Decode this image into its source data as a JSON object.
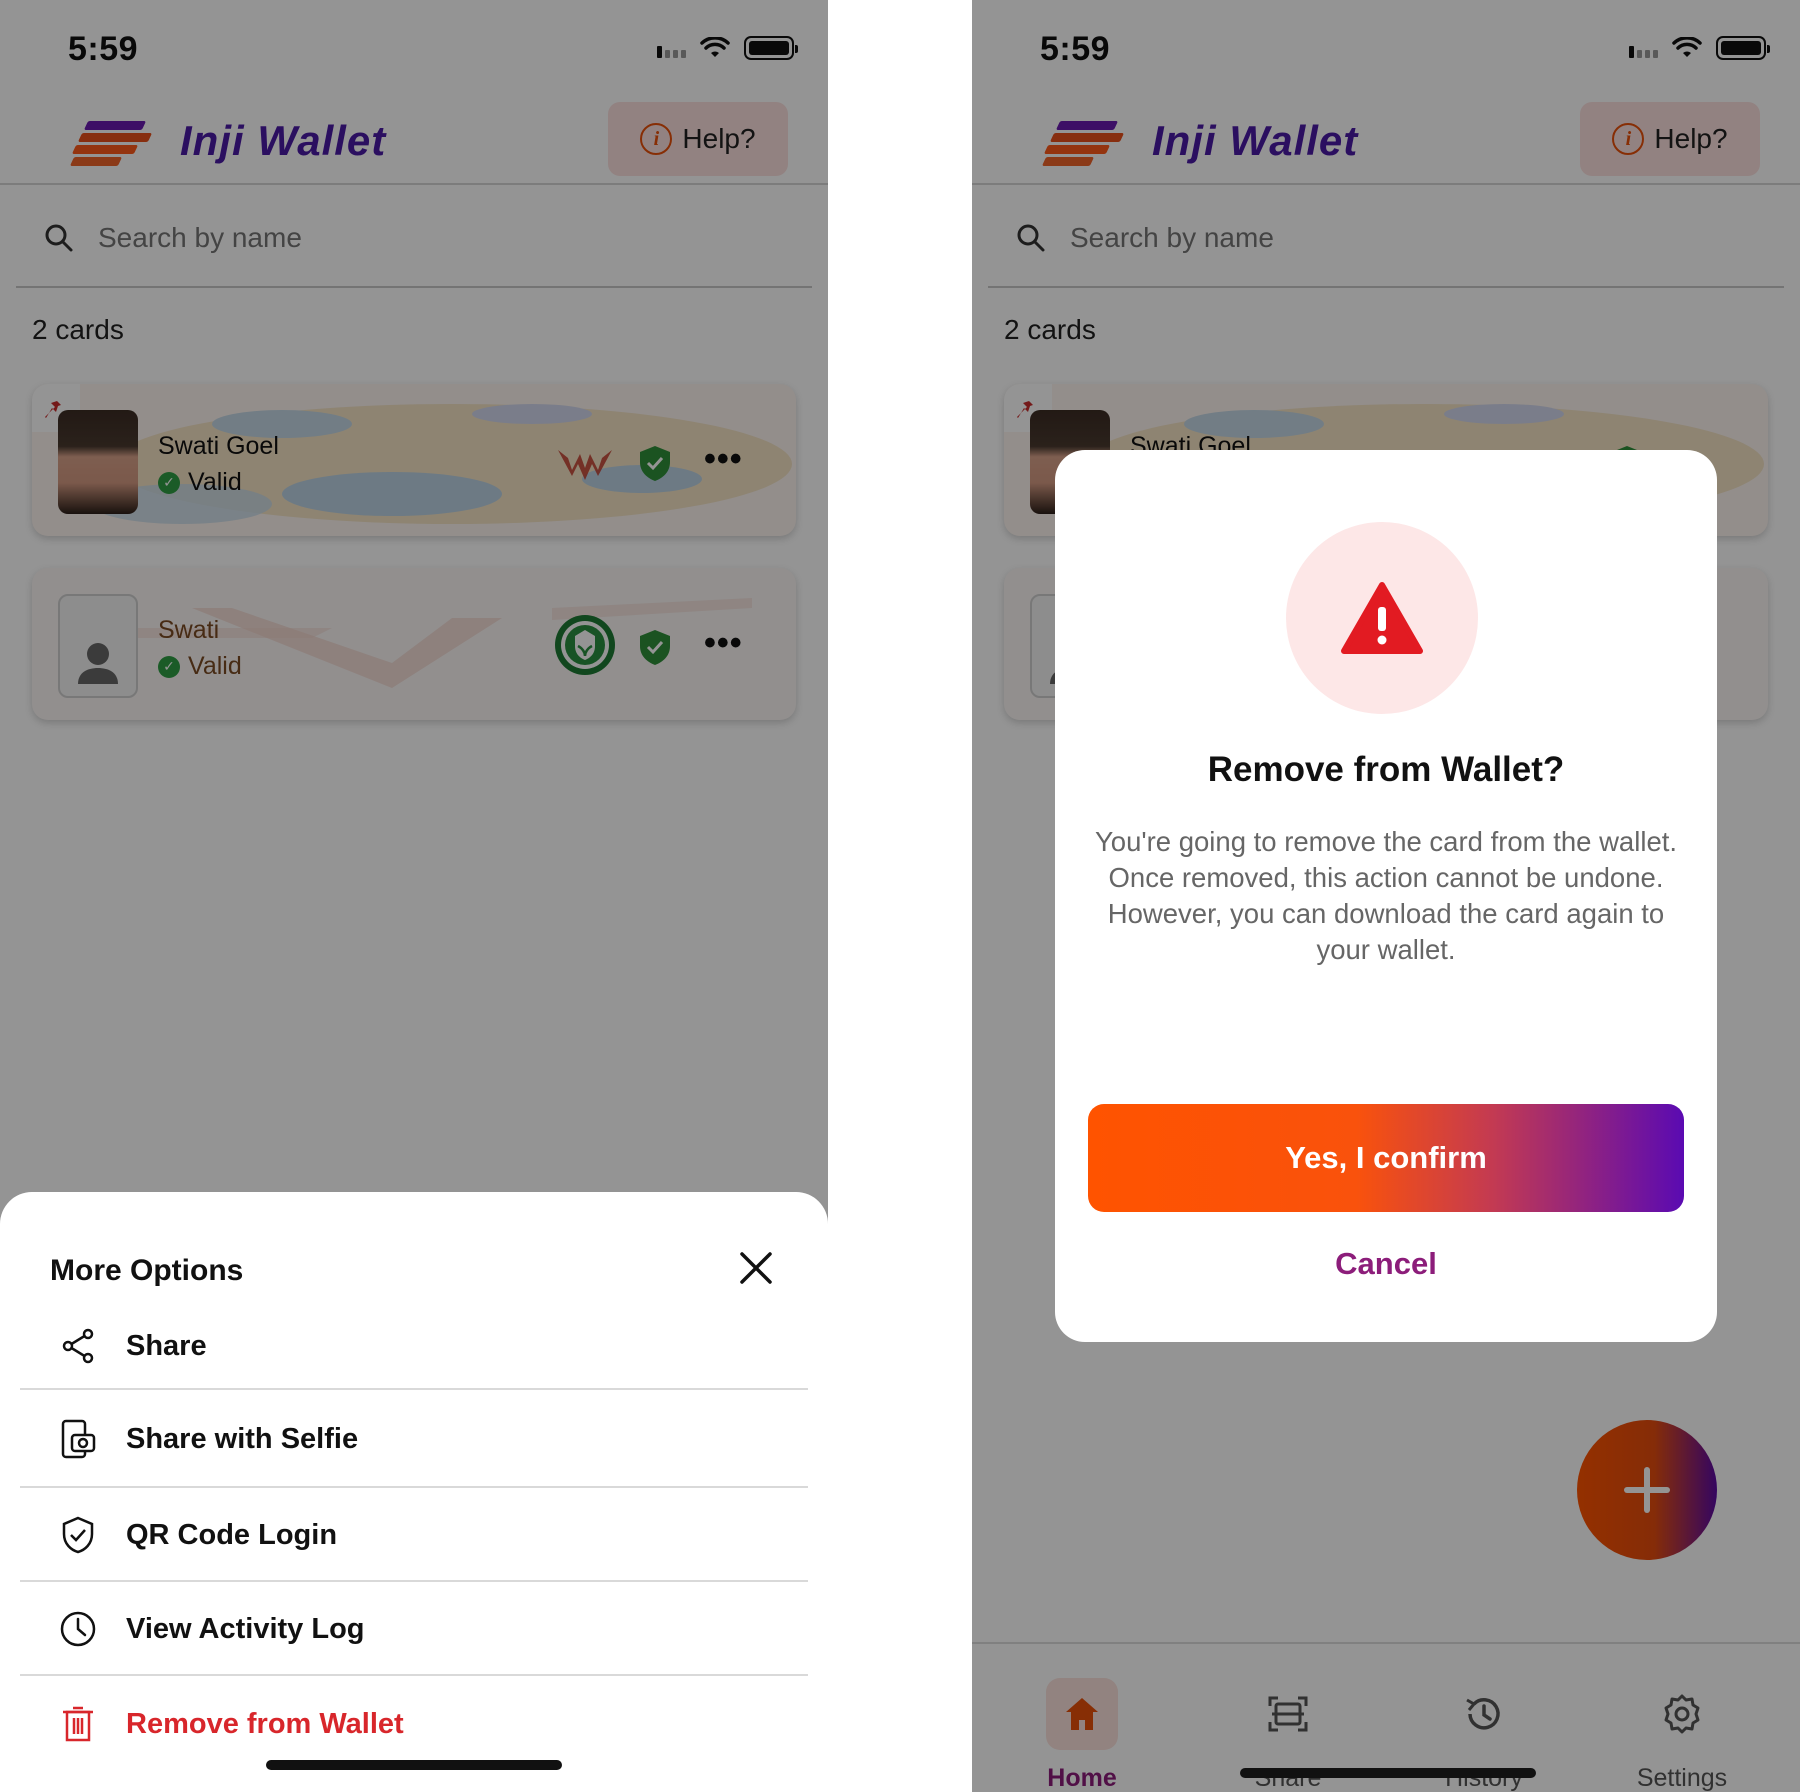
{
  "status": {
    "time": "5:59"
  },
  "header": {
    "app_name": "Inji Wallet",
    "help_label": "Help?"
  },
  "search": {
    "placeholder": "Search by name"
  },
  "cards_count": "2 cards",
  "cards": [
    {
      "name": "Swati Goel",
      "status": "Valid"
    },
    {
      "name": "Swati",
      "status": "Valid"
    }
  ],
  "more_options": {
    "title": "More Options",
    "items": [
      {
        "label": "Share",
        "icon": "share-icon"
      },
      {
        "label": "Share with Selfie",
        "icon": "share-selfie-icon"
      },
      {
        "label": "QR Code Login",
        "icon": "shield-check-icon"
      },
      {
        "label": "View Activity Log",
        "icon": "clock-icon"
      },
      {
        "label": "Remove from Wallet",
        "icon": "trash-icon"
      }
    ]
  },
  "dialog": {
    "title": "Remove from Wallet?",
    "body_line1": "You're going to remove the card from the wallet. Once removed, this action cannot be undone.",
    "body_line2": "However, you can download the card again to your wallet.",
    "confirm_label": "Yes, I confirm",
    "cancel_label": "Cancel"
  },
  "tabs": [
    {
      "label": "Home",
      "icon": "home-icon",
      "active": true
    },
    {
      "label": "Share",
      "icon": "scan-icon",
      "active": false
    },
    {
      "label": "History",
      "icon": "history-icon",
      "active": false
    },
    {
      "label": "Settings",
      "icon": "gear-icon",
      "active": false
    }
  ],
  "colors": {
    "brand_purple": "#4b1aa6",
    "accent_orange": "#ff5300",
    "accent_magenta": "#8c1d7a",
    "danger_red": "#d8262b",
    "valid_green": "#2f9e44"
  }
}
